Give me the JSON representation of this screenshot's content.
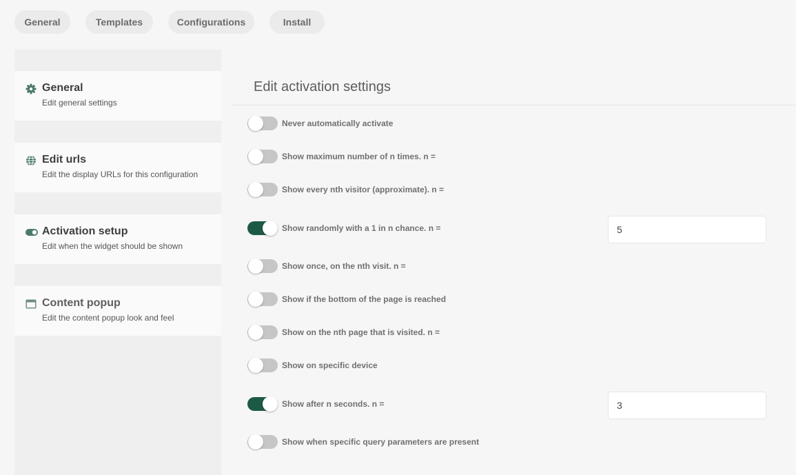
{
  "tabs": [
    {
      "label": "General"
    },
    {
      "label": "Templates"
    },
    {
      "label": "Configurations"
    },
    {
      "label": "Install"
    }
  ],
  "sidebar": {
    "items": [
      {
        "icon": "gear-icon",
        "title": "General",
        "subtitle": "Edit general settings"
      },
      {
        "icon": "globe-icon",
        "title": "Edit urls",
        "subtitle": "Edit the display URLs for this configuration"
      },
      {
        "icon": "toggle-icon",
        "title": "Activation setup",
        "subtitle": "Edit when the widget should be shown"
      },
      {
        "icon": "window-icon",
        "title": "Content popup",
        "subtitle": "Edit the content popup look and feel"
      }
    ]
  },
  "main": {
    "title": "Edit activation settings",
    "options": [
      {
        "label": "Never automatically activate",
        "enabled": false
      },
      {
        "label": "Show maximum number of n times. n =",
        "enabled": false
      },
      {
        "label": "Show every nth visitor (approximate). n =",
        "enabled": false
      },
      {
        "label": "Show randomly with a 1 in n chance. n =",
        "enabled": true,
        "value": "5"
      },
      {
        "label": "Show once, on the nth visit. n =",
        "enabled": false
      },
      {
        "label": "Show if the bottom of the page is reached",
        "enabled": false
      },
      {
        "label": "Show on the nth page that is visited. n =",
        "enabled": false
      },
      {
        "label": "Show on specific device",
        "enabled": false
      },
      {
        "label": "Show after n seconds. n =",
        "enabled": true,
        "value": "3"
      },
      {
        "label": "Show when specific query parameters are present",
        "enabled": false
      }
    ]
  },
  "colors": {
    "accent": "#1c5a46",
    "toggle_off": "#c6c6c6",
    "icon": "#4a7a6a",
    "icon_muted": "#6e8e82"
  }
}
